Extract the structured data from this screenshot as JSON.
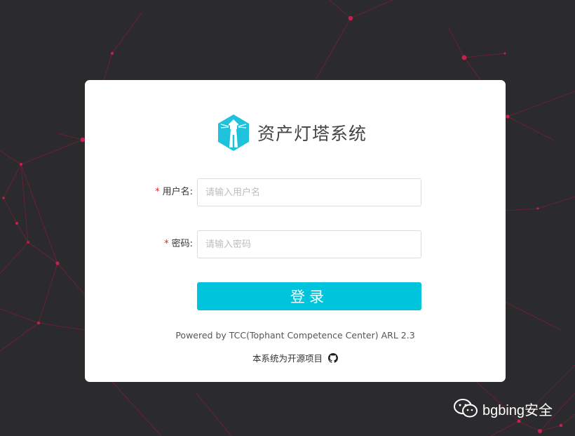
{
  "brand": {
    "title": "资产灯塔系统",
    "logo_icon": "lighthouse-icon",
    "logo_color": "#1fc2dc"
  },
  "form": {
    "username": {
      "label": "用户名:",
      "required_mark": "*",
      "placeholder": "请输入用户名",
      "value": ""
    },
    "password": {
      "label": "密码:",
      "required_mark": "*",
      "placeholder": "请输入密码",
      "value": ""
    },
    "submit_label": "登录"
  },
  "footer": {
    "powered_by": "Powered by TCC(Tophant Competence Center) ARL 2.3",
    "open_source_text": "本系统为开源项目",
    "github_icon": "github-icon"
  },
  "watermark": {
    "icon": "wechat-icon",
    "text": "bgbing安全"
  },
  "colors": {
    "background": "#2b2b2d",
    "network_lines": "#c81f50",
    "accent": "#00c4dc",
    "required": "#e0281f"
  }
}
